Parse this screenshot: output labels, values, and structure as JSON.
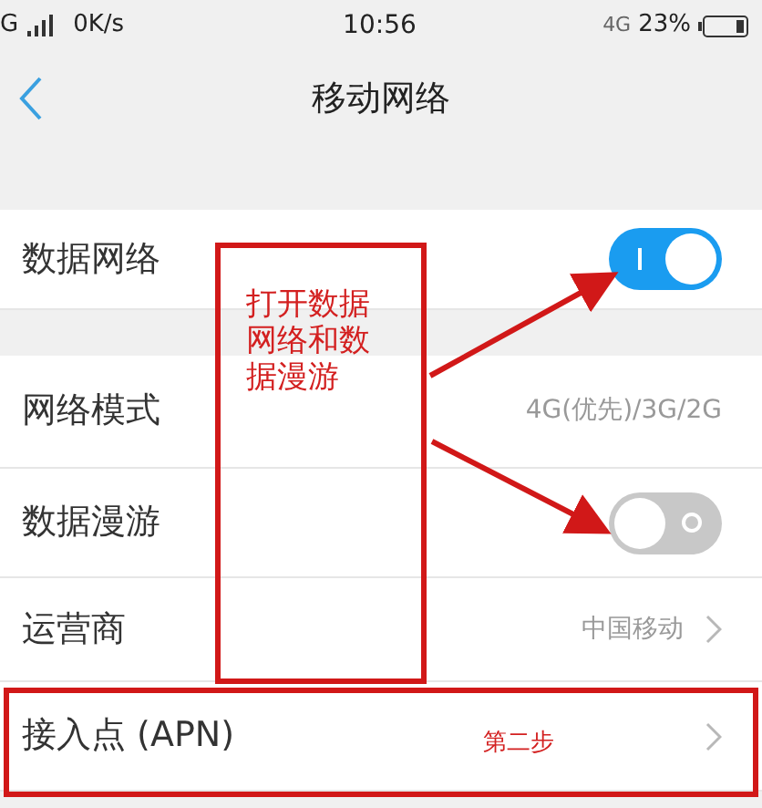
{
  "status_bar": {
    "network": "G",
    "speed": "0K/s",
    "time": "10:56",
    "network_right": "4G",
    "battery": "23%"
  },
  "header": {
    "title": "移动网络"
  },
  "sections": [
    {
      "rows": [
        {
          "kind": "toggle",
          "label": "数据网络",
          "on": true
        }
      ]
    },
    {
      "rows": [
        {
          "kind": "value",
          "label": "网络模式",
          "value": "4G(优先)/3G/2G"
        },
        {
          "kind": "toggle",
          "label": "数据漫游",
          "on": false
        },
        {
          "kind": "link",
          "label": "运营商",
          "value": "中国移动"
        },
        {
          "kind": "link",
          "label": "接入点 (APN)"
        }
      ]
    }
  ],
  "annotations": {
    "note": "打开数据网络和数据漫游",
    "step": "第二步"
  }
}
